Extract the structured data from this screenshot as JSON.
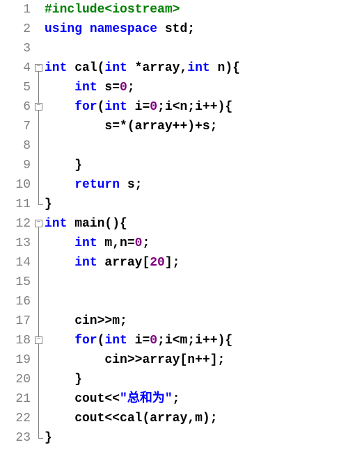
{
  "lines": [
    {
      "n": "1",
      "fold": "none",
      "tokens": [
        {
          "t": "#include<iostream>",
          "c": "kw-green"
        }
      ]
    },
    {
      "n": "2",
      "fold": "none",
      "tokens": [
        {
          "t": "using",
          "c": "kw-blue"
        },
        {
          "t": " ",
          "c": "op"
        },
        {
          "t": "namespace",
          "c": "kw-blue"
        },
        {
          "t": " std",
          "c": "op"
        },
        {
          "t": ";",
          "c": "op"
        }
      ]
    },
    {
      "n": "3",
      "fold": "none",
      "tokens": []
    },
    {
      "n": "4",
      "fold": "open",
      "tokens": [
        {
          "t": "int",
          "c": "kw-blue"
        },
        {
          "t": " cal",
          "c": "op"
        },
        {
          "t": "(",
          "c": "op"
        },
        {
          "t": "int",
          "c": "kw-blue"
        },
        {
          "t": " ",
          "c": "op"
        },
        {
          "t": "*",
          "c": "op"
        },
        {
          "t": "array",
          "c": "op"
        },
        {
          "t": ",",
          "c": "op"
        },
        {
          "t": "int",
          "c": "kw-blue"
        },
        {
          "t": " n",
          "c": "op"
        },
        {
          "t": ")",
          "c": "op"
        },
        {
          "t": "{",
          "c": "op"
        }
      ]
    },
    {
      "n": "5",
      "fold": "line",
      "tokens": [
        {
          "t": "    ",
          "c": "op"
        },
        {
          "t": "int",
          "c": "kw-blue"
        },
        {
          "t": " s",
          "c": "op"
        },
        {
          "t": "=",
          "c": "op"
        },
        {
          "t": "0",
          "c": "num"
        },
        {
          "t": ";",
          "c": "op"
        }
      ]
    },
    {
      "n": "6",
      "fold": "open-in",
      "tokens": [
        {
          "t": "    ",
          "c": "op"
        },
        {
          "t": "for",
          "c": "kw-blue"
        },
        {
          "t": "(",
          "c": "op"
        },
        {
          "t": "int",
          "c": "kw-blue"
        },
        {
          "t": " i",
          "c": "op"
        },
        {
          "t": "=",
          "c": "op"
        },
        {
          "t": "0",
          "c": "num"
        },
        {
          "t": ";",
          "c": "op"
        },
        {
          "t": "i",
          "c": "op"
        },
        {
          "t": "<",
          "c": "op"
        },
        {
          "t": "n",
          "c": "op"
        },
        {
          "t": ";",
          "c": "op"
        },
        {
          "t": "i",
          "c": "op"
        },
        {
          "t": "++",
          "c": "op"
        },
        {
          "t": ")",
          "c": "op"
        },
        {
          "t": "{",
          "c": "op"
        }
      ]
    },
    {
      "n": "7",
      "fold": "line",
      "tokens": [
        {
          "t": "        s",
          "c": "op"
        },
        {
          "t": "=*(",
          "c": "op"
        },
        {
          "t": "array",
          "c": "op"
        },
        {
          "t": "++)+",
          "c": "op"
        },
        {
          "t": "s",
          "c": "op"
        },
        {
          "t": ";",
          "c": "op"
        }
      ]
    },
    {
      "n": "8",
      "fold": "line",
      "tokens": []
    },
    {
      "n": "9",
      "fold": "line",
      "tokens": [
        {
          "t": "    ",
          "c": "op"
        },
        {
          "t": "}",
          "c": "op"
        }
      ]
    },
    {
      "n": "10",
      "fold": "line",
      "tokens": [
        {
          "t": "    ",
          "c": "op"
        },
        {
          "t": "return",
          "c": "kw-blue"
        },
        {
          "t": " s",
          "c": "op"
        },
        {
          "t": ";",
          "c": "op"
        }
      ]
    },
    {
      "n": "11",
      "fold": "close",
      "tokens": [
        {
          "t": "}",
          "c": "op"
        }
      ]
    },
    {
      "n": "12",
      "fold": "open",
      "tokens": [
        {
          "t": "int",
          "c": "kw-blue"
        },
        {
          "t": " main",
          "c": "op"
        },
        {
          "t": "()",
          "c": "op"
        },
        {
          "t": "{",
          "c": "op"
        }
      ]
    },
    {
      "n": "13",
      "fold": "line",
      "tokens": [
        {
          "t": "    ",
          "c": "op"
        },
        {
          "t": "int",
          "c": "kw-blue"
        },
        {
          "t": " m",
          "c": "op"
        },
        {
          "t": ",",
          "c": "op"
        },
        {
          "t": "n",
          "c": "op"
        },
        {
          "t": "=",
          "c": "op"
        },
        {
          "t": "0",
          "c": "num"
        },
        {
          "t": ";",
          "c": "op"
        }
      ]
    },
    {
      "n": "14",
      "fold": "line",
      "tokens": [
        {
          "t": "    ",
          "c": "op"
        },
        {
          "t": "int",
          "c": "kw-blue"
        },
        {
          "t": " array",
          "c": "op"
        },
        {
          "t": "[",
          "c": "op"
        },
        {
          "t": "20",
          "c": "num"
        },
        {
          "t": "]",
          "c": "op"
        },
        {
          "t": ";",
          "c": "op"
        }
      ]
    },
    {
      "n": "15",
      "fold": "line",
      "tokens": []
    },
    {
      "n": "16",
      "fold": "line",
      "tokens": []
    },
    {
      "n": "17",
      "fold": "line",
      "tokens": [
        {
          "t": "    cin",
          "c": "op"
        },
        {
          "t": ">>",
          "c": "op"
        },
        {
          "t": "m",
          "c": "op"
        },
        {
          "t": ";",
          "c": "op"
        }
      ]
    },
    {
      "n": "18",
      "fold": "open-in",
      "tokens": [
        {
          "t": "    ",
          "c": "op"
        },
        {
          "t": "for",
          "c": "kw-blue"
        },
        {
          "t": "(",
          "c": "op"
        },
        {
          "t": "int",
          "c": "kw-blue"
        },
        {
          "t": " i",
          "c": "op"
        },
        {
          "t": "=",
          "c": "op"
        },
        {
          "t": "0",
          "c": "num"
        },
        {
          "t": ";",
          "c": "op"
        },
        {
          "t": "i",
          "c": "op"
        },
        {
          "t": "<",
          "c": "op"
        },
        {
          "t": "m",
          "c": "op"
        },
        {
          "t": ";",
          "c": "op"
        },
        {
          "t": "i",
          "c": "op"
        },
        {
          "t": "++",
          "c": "op"
        },
        {
          "t": ")",
          "c": "op"
        },
        {
          "t": "{",
          "c": "op"
        }
      ]
    },
    {
      "n": "19",
      "fold": "line",
      "tokens": [
        {
          "t": "        cin",
          "c": "op"
        },
        {
          "t": ">>",
          "c": "op"
        },
        {
          "t": "array",
          "c": "op"
        },
        {
          "t": "[",
          "c": "op"
        },
        {
          "t": "n",
          "c": "op"
        },
        {
          "t": "++",
          "c": "op"
        },
        {
          "t": "]",
          "c": "op"
        },
        {
          "t": ";",
          "c": "op"
        }
      ]
    },
    {
      "n": "20",
      "fold": "line",
      "tokens": [
        {
          "t": "    ",
          "c": "op"
        },
        {
          "t": "}",
          "c": "op"
        }
      ]
    },
    {
      "n": "21",
      "fold": "line",
      "tokens": [
        {
          "t": "    cout",
          "c": "op"
        },
        {
          "t": "<<",
          "c": "op"
        },
        {
          "t": "\"总和为\"",
          "c": "str"
        },
        {
          "t": ";",
          "c": "op"
        }
      ]
    },
    {
      "n": "22",
      "fold": "line",
      "tokens": [
        {
          "t": "    cout",
          "c": "op"
        },
        {
          "t": "<<",
          "c": "op"
        },
        {
          "t": "cal",
          "c": "op"
        },
        {
          "t": "(",
          "c": "op"
        },
        {
          "t": "array",
          "c": "op"
        },
        {
          "t": ",",
          "c": "op"
        },
        {
          "t": "m",
          "c": "op"
        },
        {
          "t": ")",
          "c": "op"
        },
        {
          "t": ";",
          "c": "op"
        }
      ]
    },
    {
      "n": "23",
      "fold": "close",
      "tokens": [
        {
          "t": "}",
          "c": "op"
        }
      ]
    }
  ]
}
